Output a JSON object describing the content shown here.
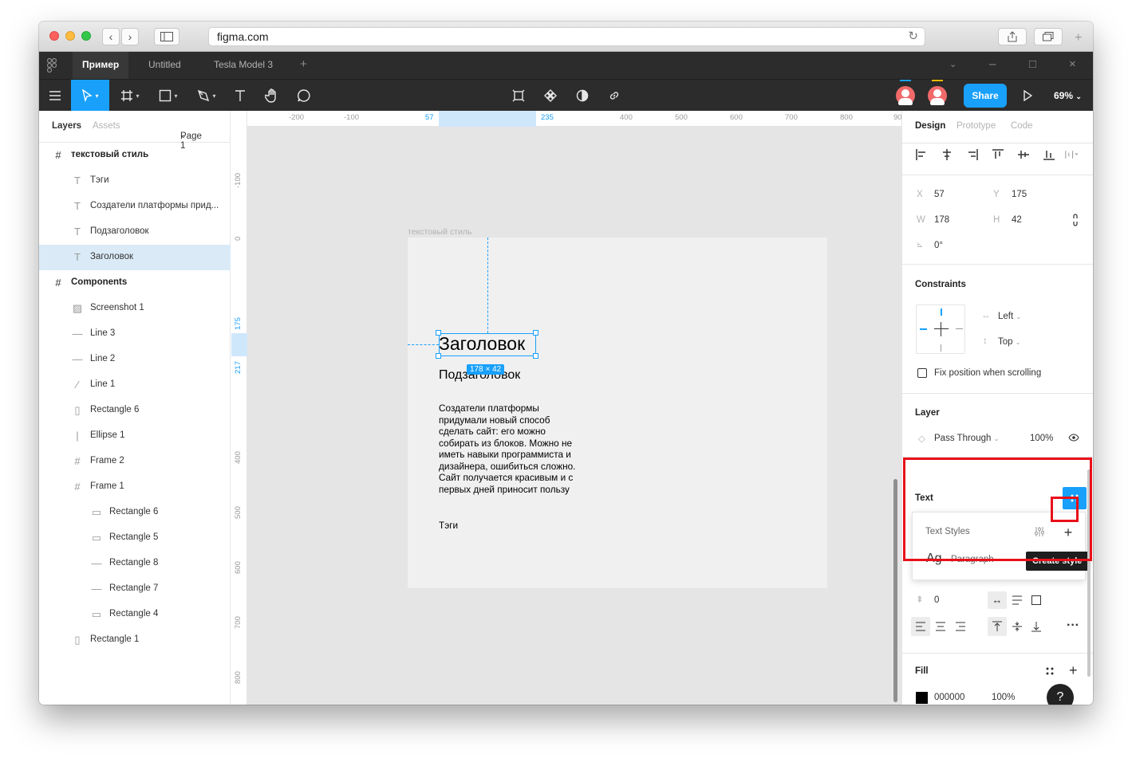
{
  "browser": {
    "url": "figma.com",
    "back_icon": "chevron-left-icon",
    "forward_icon": "chevron-right-icon"
  },
  "tabs": [
    {
      "label": "Пример",
      "active": true
    },
    {
      "label": "Untitled",
      "active": false
    },
    {
      "label": "Tesla Model 3",
      "active": false
    }
  ],
  "toolbar": {
    "share_label": "Share",
    "zoom_label": "69%"
  },
  "left_panel": {
    "tab_layers": "Layers",
    "tab_assets": "Assets",
    "page_label": "Page 1",
    "layers": [
      {
        "label": "текстовый стиль",
        "icon": "#",
        "indent": 0,
        "frame": true,
        "selected": false
      },
      {
        "label": "Тэги",
        "icon": "T",
        "indent": 1,
        "frame": false,
        "selected": false
      },
      {
        "label": "Создатели платформы прид...",
        "icon": "T",
        "indent": 1,
        "frame": false,
        "selected": false
      },
      {
        "label": "Подзаголовок",
        "icon": "T",
        "indent": 1,
        "frame": false,
        "selected": false
      },
      {
        "label": "Заголовок",
        "icon": "T",
        "indent": 1,
        "frame": false,
        "selected": true
      },
      {
        "label": "Components",
        "icon": "#",
        "indent": 0,
        "frame": true,
        "selected": false
      },
      {
        "label": "Screenshot 1",
        "icon": "▨",
        "indent": 1,
        "frame": false,
        "selected": false
      },
      {
        "label": "Line 3",
        "icon": "—",
        "indent": 1,
        "frame": false,
        "selected": false
      },
      {
        "label": "Line 2",
        "icon": "—",
        "indent": 1,
        "frame": false,
        "selected": false
      },
      {
        "label": "Line 1",
        "icon": "⁄",
        "indent": 1,
        "frame": false,
        "selected": false
      },
      {
        "label": "Rectangle 6",
        "icon": "▯",
        "indent": 1,
        "frame": false,
        "selected": false
      },
      {
        "label": "Ellipse 1",
        "icon": "|",
        "indent": 1,
        "frame": false,
        "selected": false
      },
      {
        "label": "Frame 2",
        "icon": "#",
        "indent": 1,
        "frame": false,
        "selected": false
      },
      {
        "label": "Frame 1",
        "icon": "#",
        "indent": 1,
        "frame": false,
        "selected": false
      },
      {
        "label": "Rectangle 6",
        "icon": "▭",
        "indent": 2,
        "frame": false,
        "selected": false
      },
      {
        "label": "Rectangle 5",
        "icon": "▭",
        "indent": 2,
        "frame": false,
        "selected": false
      },
      {
        "label": "Rectangle 8",
        "icon": "—",
        "indent": 2,
        "frame": false,
        "selected": false
      },
      {
        "label": "Rectangle 7",
        "icon": "—",
        "indent": 2,
        "frame": false,
        "selected": false
      },
      {
        "label": "Rectangle 4",
        "icon": "▭",
        "indent": 2,
        "frame": false,
        "selected": false
      },
      {
        "label": "Rectangle 1",
        "icon": "▯",
        "indent": 1,
        "frame": false,
        "selected": false
      }
    ]
  },
  "canvas": {
    "ruler_top": [
      "-200",
      "-100",
      "57",
      "235",
      "400",
      "500",
      "600",
      "700",
      "800",
      "90"
    ],
    "ruler_left": [
      "-100",
      "0",
      "175",
      "217",
      "400",
      "500",
      "600",
      "700",
      "800"
    ],
    "frame_name": "текстовый стиль",
    "heading": "Заголовок",
    "subheading": "Подзаголовок",
    "paragraph": "Создатели платформы придумали новый способ сделать сайт: его можно собирать из блоков. Можно не иметь навыки программиста и дизайнера, ошибиться сложно. Сайт получается красивым и с первых дней приносит пользу",
    "tags": "Тэги",
    "dimension_badge": "178 × 42"
  },
  "right_panel": {
    "tab_design": "Design",
    "tab_prototype": "Prototype",
    "tab_code": "Code",
    "x_label": "X",
    "x_value": "57",
    "y_label": "Y",
    "y_value": "175",
    "w_label": "W",
    "w_value": "178",
    "h_label": "H",
    "h_value": "42",
    "rotation_value": "0°",
    "constraints_title": "Constraints",
    "constraint_h": "Left",
    "constraint_v": "Top",
    "fix_position_label": "Fix position when scrolling",
    "layer_title": "Layer",
    "blend_mode": "Pass Through",
    "layer_opacity": "100%",
    "text_title": "Text",
    "text_styles_label": "Text Styles",
    "style_sample": "Ag",
    "style_name": "Paragraph",
    "tooltip": "Create style",
    "paragraph_spacing": "0",
    "fill_title": "Fill",
    "fill_hex": "000000",
    "fill_opacity": "100%",
    "help_label": "?"
  },
  "colors": {
    "accent": "#18a0fb",
    "highlight": "#e8101a",
    "toolbar_bg": "#2c2c2c"
  }
}
